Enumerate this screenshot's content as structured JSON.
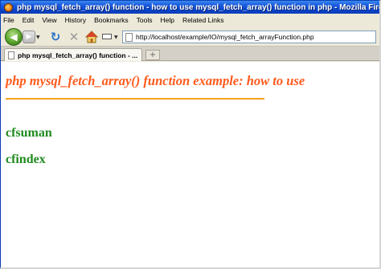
{
  "window": {
    "title": "php mysql_fetch_array() function - how to use mysql_fetch_array() function in php - Mozilla Firefox"
  },
  "menu": [
    "File",
    "Edit",
    "View",
    "History",
    "Bookmarks",
    "Tools",
    "Help",
    "Related Links"
  ],
  "navigation": {
    "url": "http://localhost/example/IO/mysql_fetch_arrayFunction.php"
  },
  "tabs": [
    {
      "label": "php mysql_fetch_array() function - ..."
    }
  ],
  "content": {
    "heading": "php mysql_fetch_array() function example: how to use",
    "items": [
      "cfsuman",
      "cfindex"
    ]
  },
  "colors": {
    "heading": "#ff5a1c",
    "rule": "#f4a21f",
    "items": "#1f8a1f"
  }
}
